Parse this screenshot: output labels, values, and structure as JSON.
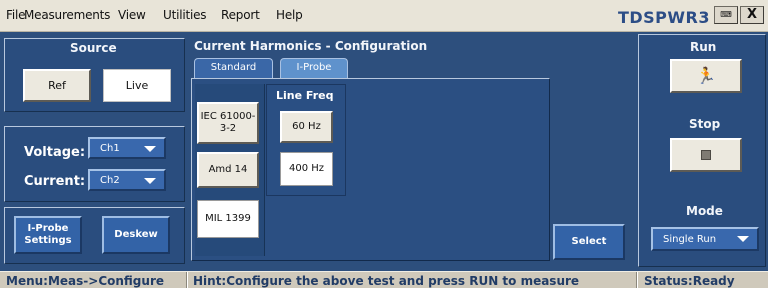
{
  "menubar": {
    "items": [
      "File",
      "Measurements",
      "View",
      "Utilities",
      "Report",
      "Help"
    ],
    "app_title": "TDSPWR3",
    "keyboard_button": "⌨",
    "close_button": "X"
  },
  "source": {
    "title": "Source",
    "ref_label": "Ref",
    "live_label": "Live"
  },
  "channels": {
    "voltage_label": "Voltage:",
    "voltage_value": "Ch1",
    "current_label": "Current:",
    "current_value": "Ch2"
  },
  "bottom_left": {
    "iprobe_settings_label": "I-Probe Settings",
    "deskew_label": "Deskew"
  },
  "config": {
    "title": "Current Harmonics - Configuration",
    "tabs": [
      {
        "label": "Standard",
        "active": true
      },
      {
        "label": "I-Probe",
        "active": false
      }
    ],
    "standards": [
      "IEC 61000-3-2",
      "Amd 14",
      "MIL 1399"
    ],
    "line_freq_title": "Line Freq",
    "freqs": [
      "60 Hz",
      "400 Hz"
    ],
    "select_label": "Select"
  },
  "right_panel": {
    "run_title": "Run",
    "run_icon": "running-man-icon",
    "stop_title": "Stop",
    "stop_icon": "stop-square-icon",
    "mode_title": "Mode",
    "mode_value": "Single Run"
  },
  "statusbar": {
    "menu": "Menu:Meas->Configure",
    "hint": "Hint:Configure the above test and press RUN to measure",
    "status": "Status:Ready"
  },
  "colors": {
    "background": "#2d4f7d",
    "menubar": "#e8e4d8",
    "statusbar": "#cfc9bb",
    "accent": "#3968ad"
  }
}
